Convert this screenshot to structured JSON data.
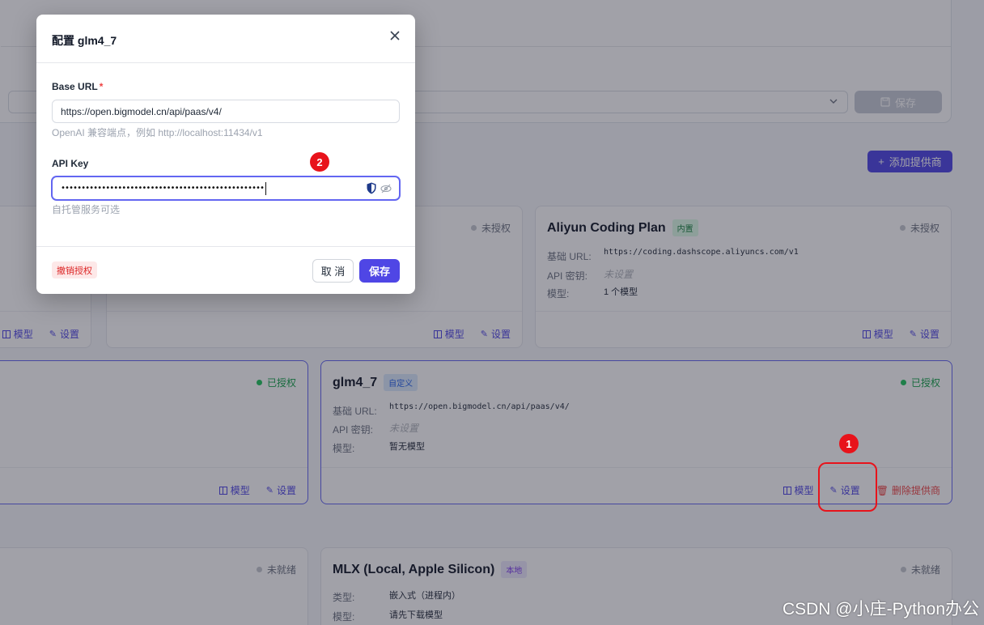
{
  "header": {
    "save_label": "保存",
    "add_provider_label": "添加提供商"
  },
  "cards": {
    "top_left": {
      "models_label": "模型",
      "settings_label": "设置"
    },
    "top_middle": {
      "status": "未授权",
      "models_label": "模型",
      "settings_label": "设置"
    },
    "aliyun": {
      "title": "Aliyun Coding Plan",
      "badge": "内置",
      "status": "未授权",
      "base_url_label": "基础 URL:",
      "base_url": "https://coding.dashscope.aliyuncs.com/v1",
      "api_key_label": "API 密钥:",
      "api_key": "未设置",
      "models_label_text": "模型:",
      "models_value": "1 个模型",
      "models_label": "模型",
      "settings_label": "设置"
    },
    "mid_left": {
      "status": "已授权",
      "models_label": "模型",
      "settings_label": "设置"
    },
    "glm": {
      "title": "glm4_7",
      "badge": "自定义",
      "status": "已授权",
      "base_url_label": "基础 URL:",
      "base_url": "https://open.bigmodel.cn/api/paas/v4/",
      "api_key_label": "API 密钥:",
      "api_key": "未设置",
      "models_label_text": "模型:",
      "models_value": "暂无模型",
      "models_label": "模型",
      "settings_label": "设置",
      "delete_label": "删除提供商"
    },
    "bottom_left": {
      "status": "未就绪"
    },
    "mlx": {
      "title": "MLX (Local, Apple Silicon)",
      "badge": "本地",
      "status": "未就绪",
      "type_label": "类型:",
      "type_value": "嵌入式（进程内）",
      "models_label_text": "模型:",
      "models_value": "请先下载模型"
    }
  },
  "modal": {
    "title": "配置 glm4_7",
    "base_url_label": "Base URL",
    "required_mark": "*",
    "base_url_value": "https://open.bigmodel.cn/api/paas/v4/",
    "base_url_hint": "OpenAI 兼容端点，例如 http://localhost:11434/v1",
    "api_key_label": "API Key",
    "api_key_masked": "••••••••••••••••••••••••••••••••••••••••••••••••••",
    "api_key_hint": "自托管服务可选",
    "revoke_label": "撤销授权",
    "cancel_label": "取 消",
    "save_label": "保存"
  },
  "annotations": {
    "marker_1": "1",
    "marker_2": "2"
  },
  "watermark": "CSDN @小庄-Python办公",
  "colors": {
    "accent": "#4f46e5",
    "authorized": "#22c55e",
    "annotation": "#e8131b"
  }
}
